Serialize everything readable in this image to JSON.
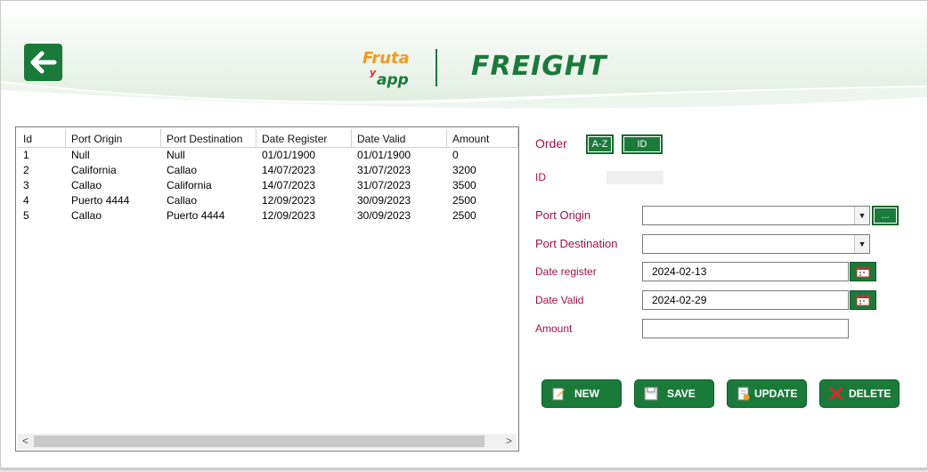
{
  "window": {
    "close_glyph": "✕"
  },
  "header": {
    "logo_text_top": "Fruta",
    "logo_text_mid": "y",
    "logo_text_bottom": "app",
    "title": "FREIGHT"
  },
  "list": {
    "columns": [
      "Id",
      "Port Origin",
      "Port Destination",
      "Date Register",
      "Date Valid",
      "Amount"
    ],
    "rows": [
      [
        "1",
        "Null",
        "Null",
        "01/01/1900",
        "01/01/1900",
        "0"
      ],
      [
        "2",
        "California",
        "Callao",
        "14/07/2023",
        "31/07/2023",
        "3200"
      ],
      [
        "3",
        "Callao",
        "California",
        "14/07/2023",
        "31/07/2023",
        "3500"
      ],
      [
        "4",
        "Puerto 4444",
        "Callao",
        "12/09/2023",
        "30/09/2023",
        "2500"
      ],
      [
        "5",
        "Callao",
        "Puerto 4444",
        "12/09/2023",
        "30/09/2023",
        "2500"
      ]
    ],
    "scroll_left": "<",
    "scroll_right": ">"
  },
  "form": {
    "order_label": "Order",
    "order_az": "A-Z",
    "order_id": "ID",
    "id_label": "ID",
    "port_origin_label": "Port Origin",
    "port_origin_value": "",
    "port_origin_more": "...",
    "port_destination_label": "Port Destination",
    "port_destination_value": "",
    "date_register_label": "Date register",
    "date_register_value": "2024-02-13",
    "date_valid_label": "Date Valid",
    "date_valid_value": "2024-02-29",
    "amount_label": "Amount",
    "amount_value": ""
  },
  "actions": {
    "new": "NEW",
    "save": "SAVE",
    "update": "UPDATE",
    "delete": "DELETE"
  },
  "colors": {
    "brand_green": "#1a7a3a",
    "label_red": "#a3104c",
    "logo_orange": "#f39a1e",
    "logo_red": "#e0262b"
  },
  "icons": [
    "back-arrow-icon",
    "calendar-icon",
    "new-icon",
    "save-icon",
    "update-icon",
    "delete-icon",
    "dropdown-arrow-icon",
    "close-icon"
  ]
}
